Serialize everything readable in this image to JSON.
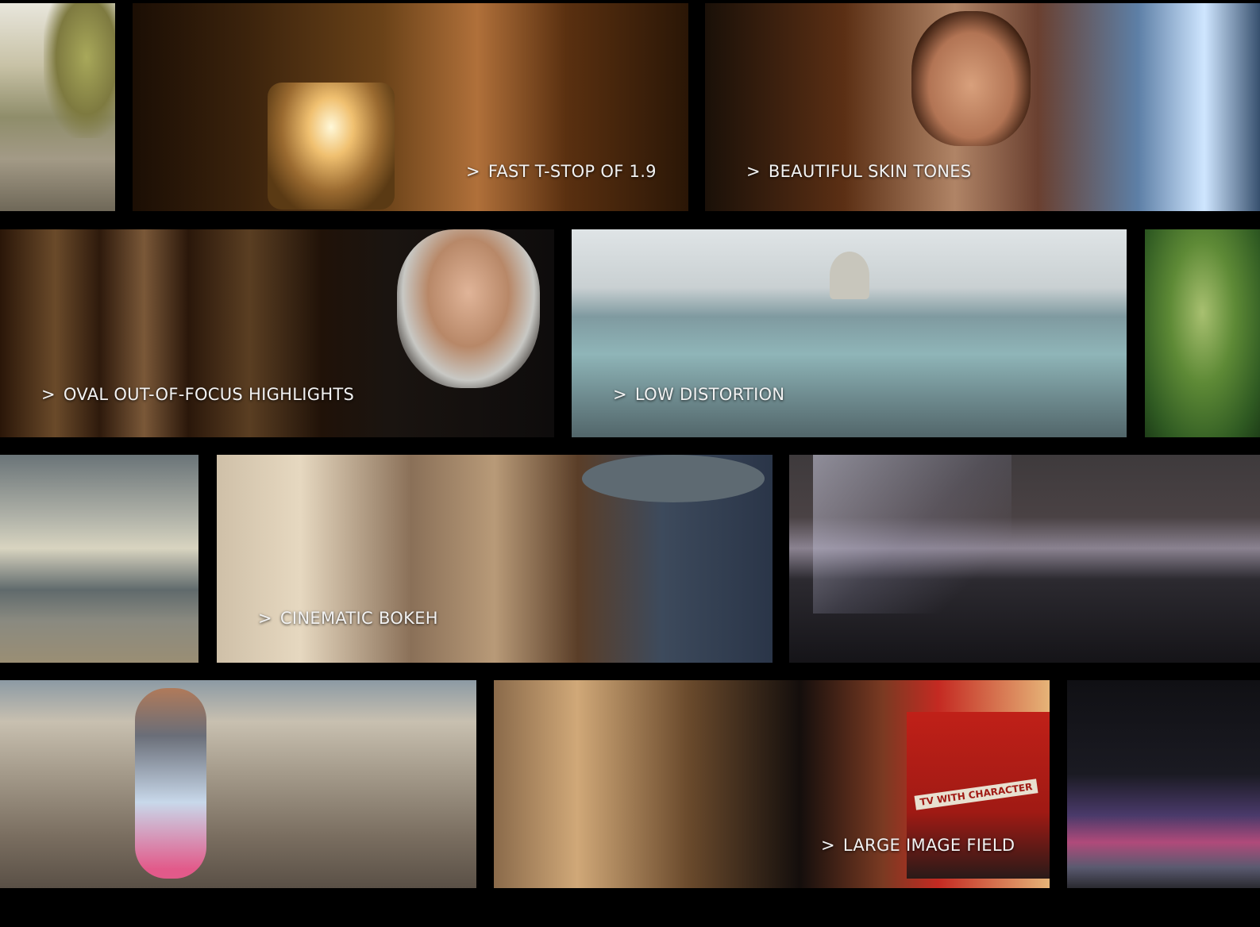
{
  "captions": {
    "fast_tstop": "FAST T-STOP OF 1.9",
    "skin_tones": "BEAUTIFUL SKIN TONES",
    "oval_highlights": "OVAL OUT-OF-FOCUS HIGHLIGHTS",
    "low_distortion": "LOW DISTORTION",
    "cinematic_bokeh": "CINEMATIC BOKEH",
    "large_image_field": "LARGE IMAGE FIELD"
  },
  "arrow": ">",
  "bus_text": "TV WITH CHARACTER",
  "colors": {
    "background": "#000000",
    "caption": "#f2f2f2"
  }
}
